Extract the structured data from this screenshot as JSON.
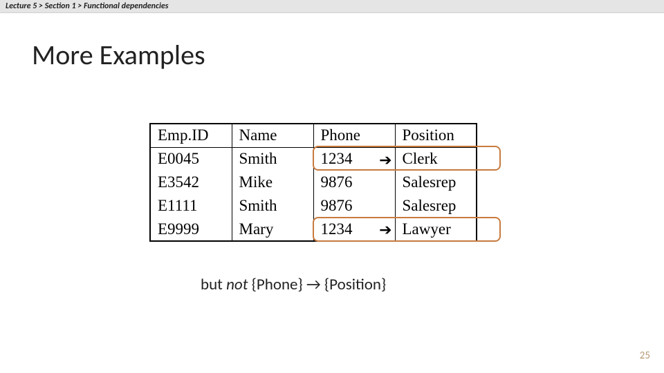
{
  "breadcrumb": {
    "full": "Lecture 5  >  Section 1  >  Functional dependencies"
  },
  "title": "More Examples",
  "table": {
    "headers": {
      "c0": "Emp.ID",
      "c1": "Name",
      "c2": "Phone",
      "c3": "Position"
    },
    "rows": [
      {
        "c0": "E0045",
        "c1": "Smith",
        "c2": "1234",
        "arrow": "➔",
        "c3": "Clerk"
      },
      {
        "c0": "E3542",
        "c1": "Mike",
        "c2": "9876",
        "arrow": "",
        "c3": "Salesrep"
      },
      {
        "c0": "E1111",
        "c1": "Smith",
        "c2": "9876",
        "arrow": "",
        "c3": "Salesrep"
      },
      {
        "c0": "E9999",
        "c1": "Mary",
        "c2": "1234",
        "arrow": "➔",
        "c3": "Lawyer"
      }
    ]
  },
  "caption": {
    "pre": "but ",
    "not": "not",
    "post": " {Phone}  →  {Position}"
  },
  "slide_number": "25",
  "highlight_color": "#c77a3e",
  "chart_data": {
    "type": "table",
    "title": "More Examples",
    "columns": [
      "Emp.ID",
      "Name",
      "Phone",
      "Position"
    ],
    "rows": [
      [
        "E0045",
        "Smith",
        "1234",
        "Clerk"
      ],
      [
        "E3542",
        "Mike",
        "9876",
        "Salesrep"
      ],
      [
        "E1111",
        "Smith",
        "9876",
        "Salesrep"
      ],
      [
        "E9999",
        "Mary",
        "1234",
        "Lawyer"
      ]
    ],
    "annotations": [
      "Highlighted rows: (Phone 1234 → Clerk) and (Phone 1234 → Lawyer)",
      "Caption: but not {Phone} → {Position}"
    ]
  }
}
